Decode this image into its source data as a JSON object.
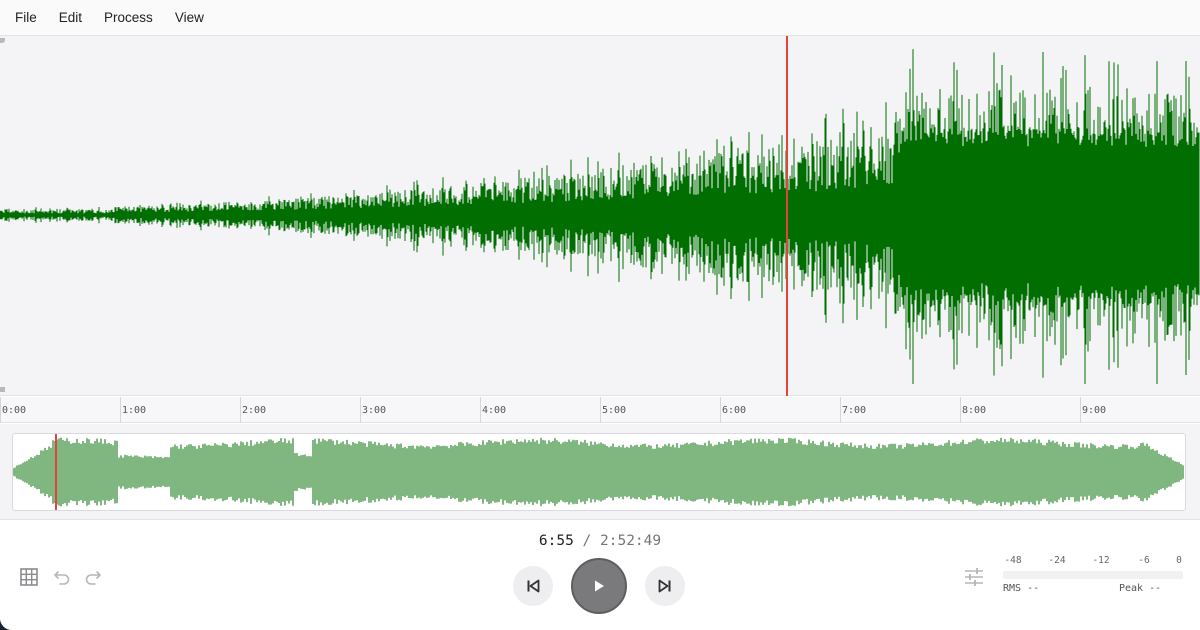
{
  "menu": {
    "items": [
      "File",
      "Edit",
      "Process",
      "View"
    ]
  },
  "colors": {
    "waveform": "#006e00",
    "playhead": "#e0443c",
    "accent": "#7a7a7d"
  },
  "timeline": {
    "labels": [
      "0:00",
      "1:00",
      "2:00",
      "3:00",
      "4:00",
      "5:00",
      "6:00",
      "7:00",
      "8:00",
      "9:00"
    ]
  },
  "transport": {
    "current_time": "6:55",
    "separator": "/",
    "total_time": "2:52:49"
  },
  "icons": {
    "grid": "grid-icon",
    "undo": "undo-icon",
    "redo": "redo-icon",
    "skip_back": "skip-back-icon",
    "play": "play-icon",
    "skip_forward": "skip-forward-icon",
    "mixer": "sliders-icon"
  },
  "meters": {
    "scale": [
      "-48",
      "-24",
      "-12",
      "-6",
      "0"
    ],
    "rms_label": "RMS",
    "rms_value": "--",
    "peak_label": "Peak",
    "peak_value": "--"
  }
}
